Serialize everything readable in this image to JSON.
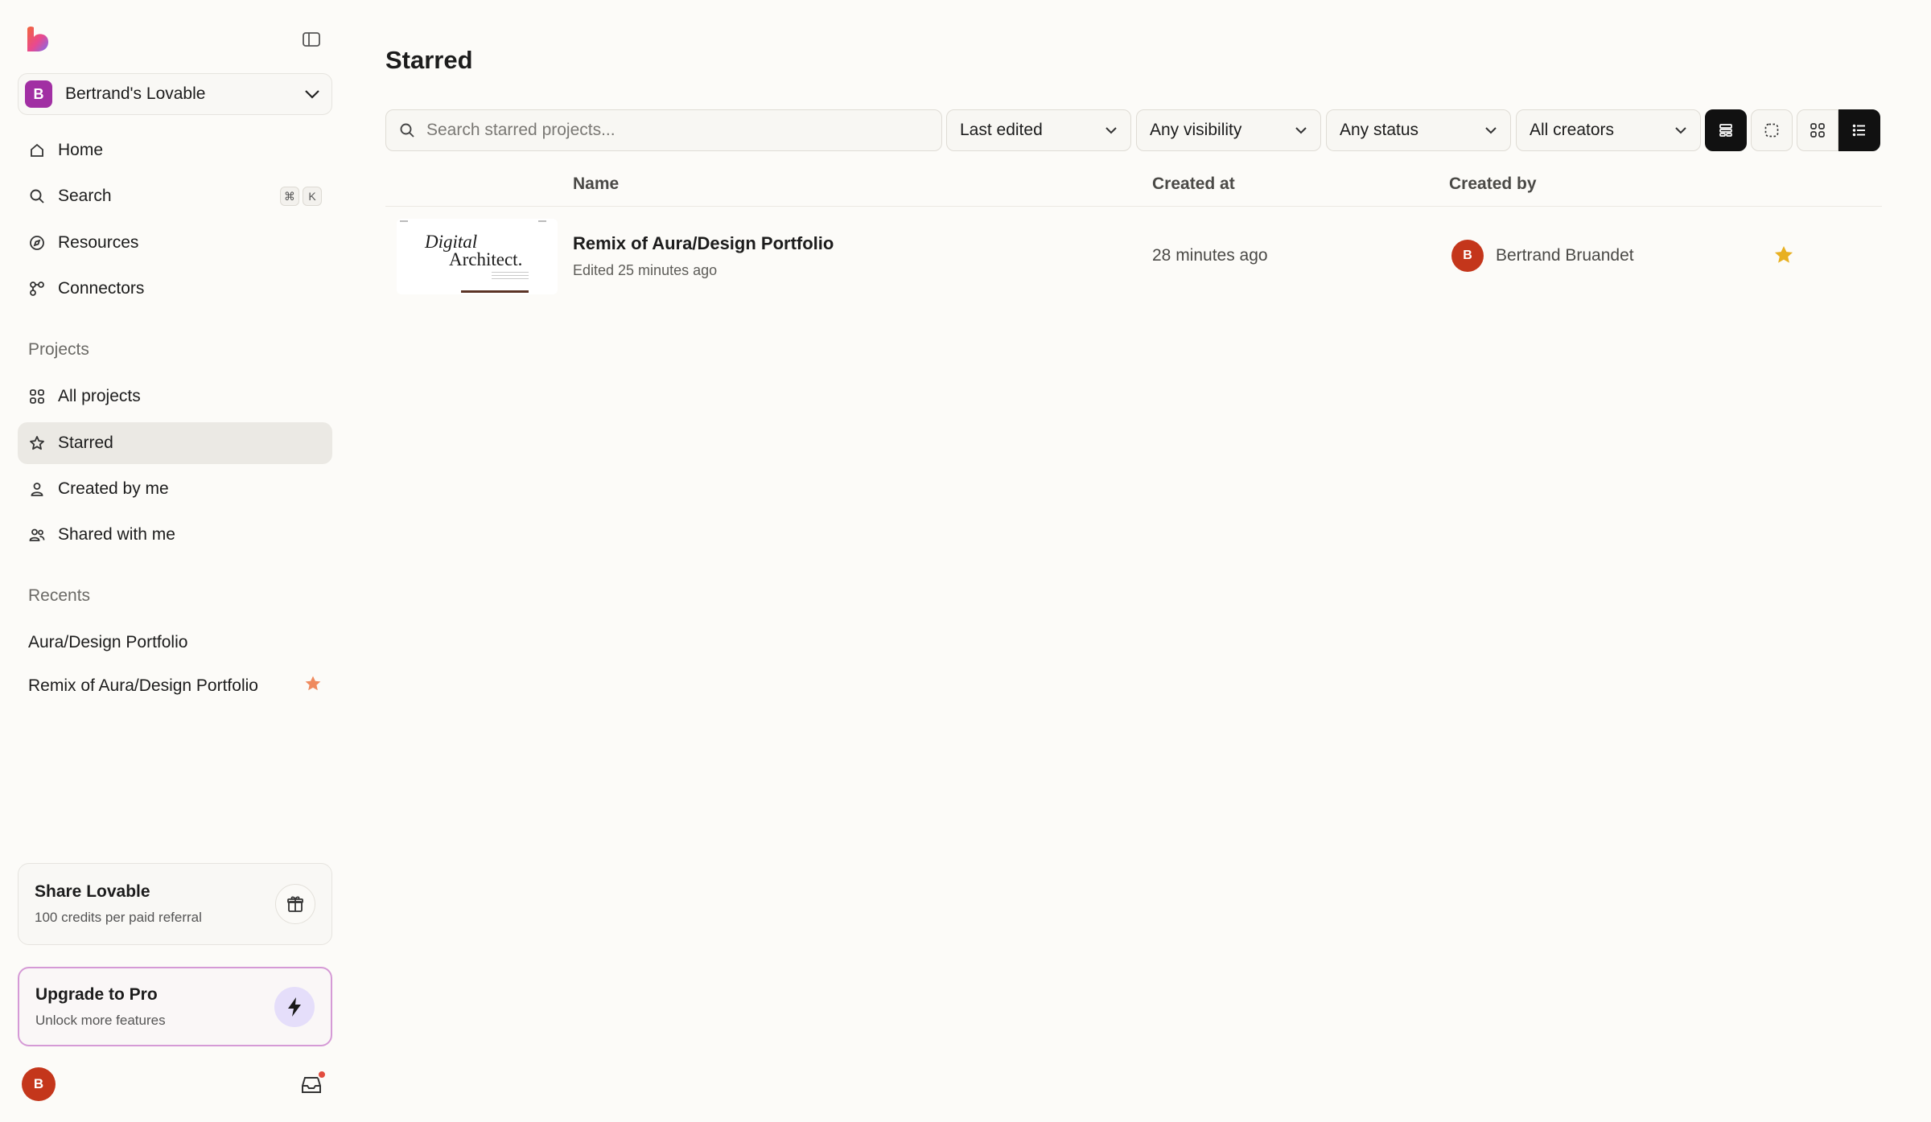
{
  "colors": {
    "accent_pink": "#a12fa3",
    "avatar_red": "#c4361b",
    "star_gold": "#e8b021",
    "star_orange": "#ef8a5e",
    "upgrade_border": "#d59ad6"
  },
  "sidebar": {
    "workspace": {
      "initial": "B",
      "name": "Bertrand's Lovable"
    },
    "nav": [
      {
        "label": "Home",
        "icon": "home-icon"
      },
      {
        "label": "Search",
        "icon": "search-icon",
        "shortcut": [
          "⌘",
          "K"
        ]
      },
      {
        "label": "Resources",
        "icon": "compass-icon"
      },
      {
        "label": "Connectors",
        "icon": "connectors-icon"
      }
    ],
    "projects_label": "Projects",
    "projects": [
      {
        "label": "All projects",
        "icon": "grid-icon"
      },
      {
        "label": "Starred",
        "icon": "star-icon",
        "active": true
      },
      {
        "label": "Created by me",
        "icon": "user-icon"
      },
      {
        "label": "Shared with me",
        "icon": "users-icon"
      }
    ],
    "recents_label": "Recents",
    "recents": [
      {
        "label": "Aura/Design Portfolio",
        "starred": false
      },
      {
        "label": "Remix of Aura/Design Portfolio",
        "starred": true
      }
    ],
    "share_card": {
      "title": "Share Lovable",
      "subtitle": "100 credits per paid referral",
      "icon": "gift-icon"
    },
    "upgrade_card": {
      "title": "Upgrade to Pro",
      "subtitle": "Unlock more features",
      "icon": "lightning-icon"
    },
    "user_initial": "B"
  },
  "main": {
    "title": "Starred",
    "search": {
      "placeholder": "Search starred projects...",
      "value": ""
    },
    "filters": {
      "sort": "Last edited",
      "visibility": "Any visibility",
      "status": "Any status",
      "creators": "All creators"
    },
    "columns": {
      "name": "Name",
      "created_at": "Created at",
      "created_by": "Created by"
    },
    "rows": [
      {
        "name": "Remix of Aura/Design Portfolio",
        "edited": "Edited 25 minutes ago",
        "created_at": "28 minutes ago",
        "creator_initial": "B",
        "creator_name": "Bertrand Bruandet",
        "starred": true,
        "thumbnail": {
          "line1": "Digital",
          "line2": "Architect."
        }
      }
    ]
  }
}
